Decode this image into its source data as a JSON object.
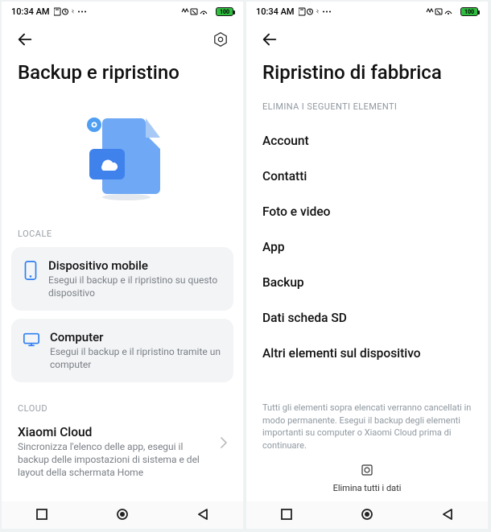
{
  "status": {
    "time": "10:34 AM",
    "battery_text": "100"
  },
  "left": {
    "title": "Backup e ripristino",
    "section_local": "LOCALE",
    "card_mobile": {
      "title": "Dispositivo mobile",
      "sub": "Esegui il backup e il ripristino su questo dispositivo"
    },
    "card_computer": {
      "title": "Computer",
      "sub": "Esegui il backup e il ripristino tramite un computer"
    },
    "section_cloud": "CLOUD",
    "cloud_row": {
      "title": "Xiaomi Cloud",
      "sub": "Sincronizza l'elenco delle app, esegui il backup delle impostazioni di sistema e del layout della schermata Home"
    }
  },
  "right": {
    "title": "Ripristino di fabbrica",
    "section_head": "ELIMINA I SEGUENTI ELEMENTI",
    "items": {
      "i0": "Account",
      "i1": "Contatti",
      "i2": "Foto e video",
      "i3": "App",
      "i4": "Backup",
      "i5": "Dati scheda SD",
      "i6": "Altri elementi sul dispositivo"
    },
    "footer": "Tutti gli elementi sopra elencati verranno cancellati in modo permanente. Esegui il backup degli elementi importanti su computer o Xiaomi Cloud prima di continuare.",
    "erase_label": "Elimina tutti i dati"
  }
}
